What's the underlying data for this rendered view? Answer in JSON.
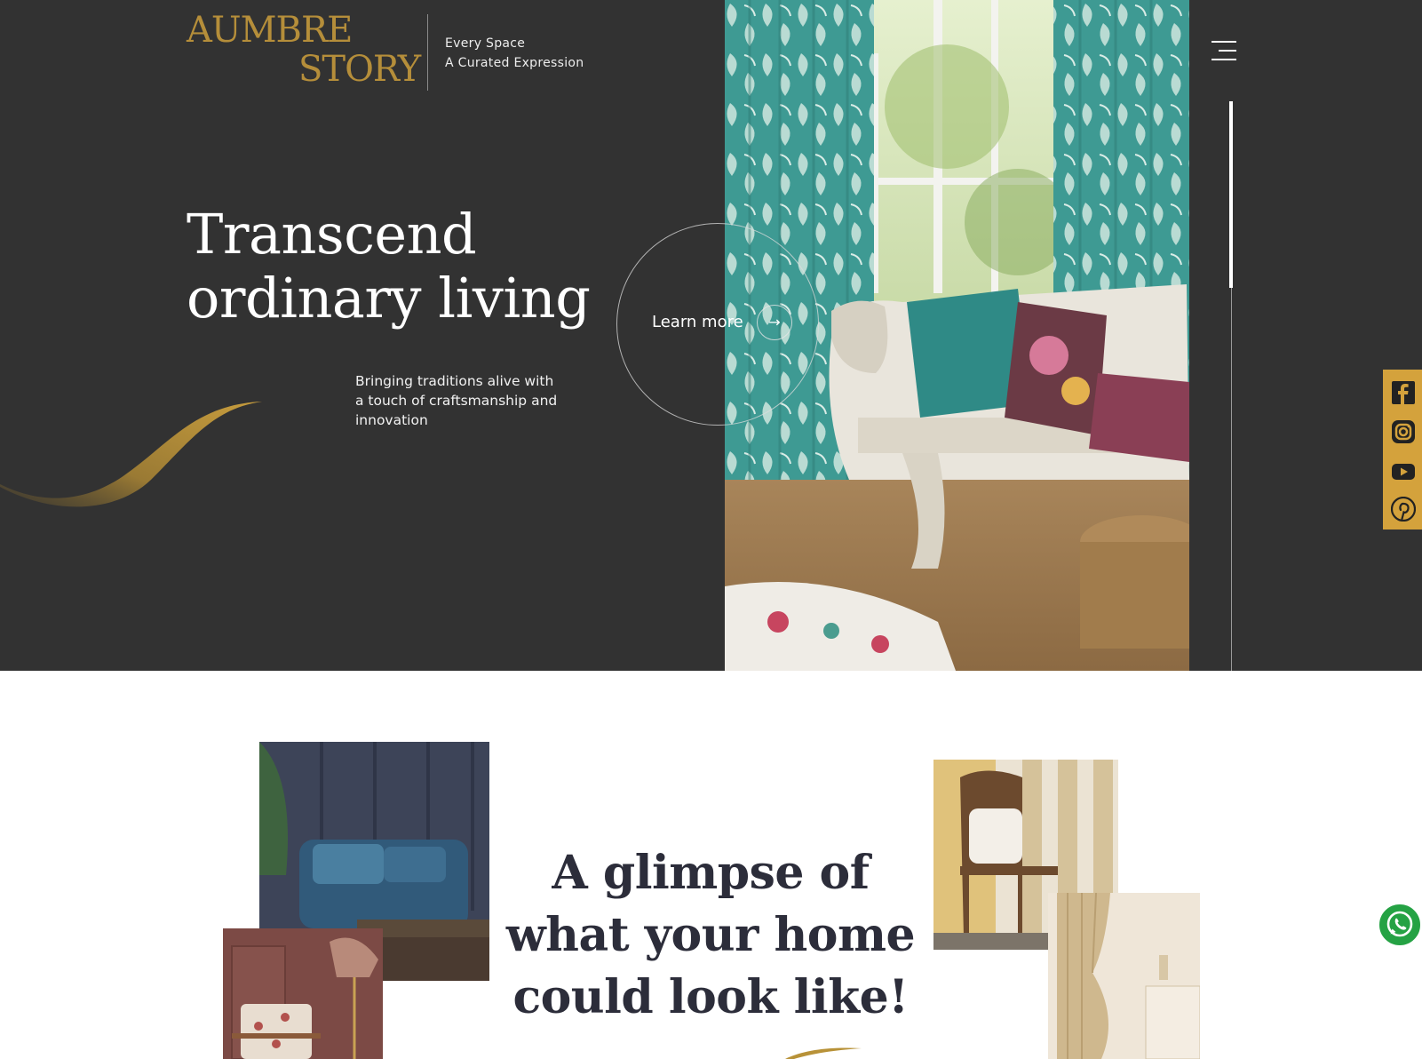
{
  "brand": {
    "logo_line1": "AUMBRE",
    "logo_line2": "STORY",
    "tagline_line1": "Every Space",
    "tagline_line2": "A Curated Expression",
    "gold": "#b58e3a"
  },
  "hero": {
    "title_line1": "Transcend",
    "title_line2": "ordinary living",
    "subtitle": "Bringing traditions alive with a touch of craftsmanship and innovation",
    "cta_label": "Learn more",
    "cta_icon": "arrow-right-icon",
    "background": "#323232"
  },
  "social": {
    "color": "#d4a23c",
    "items": [
      "facebook-icon",
      "instagram-icon",
      "youtube-icon",
      "pinterest-icon"
    ]
  },
  "section2": {
    "title": "A glimpse of what your home could look like!"
  },
  "floating": {
    "whatsapp_icon": "whatsapp-icon",
    "whatsapp_color": "#25a244"
  }
}
